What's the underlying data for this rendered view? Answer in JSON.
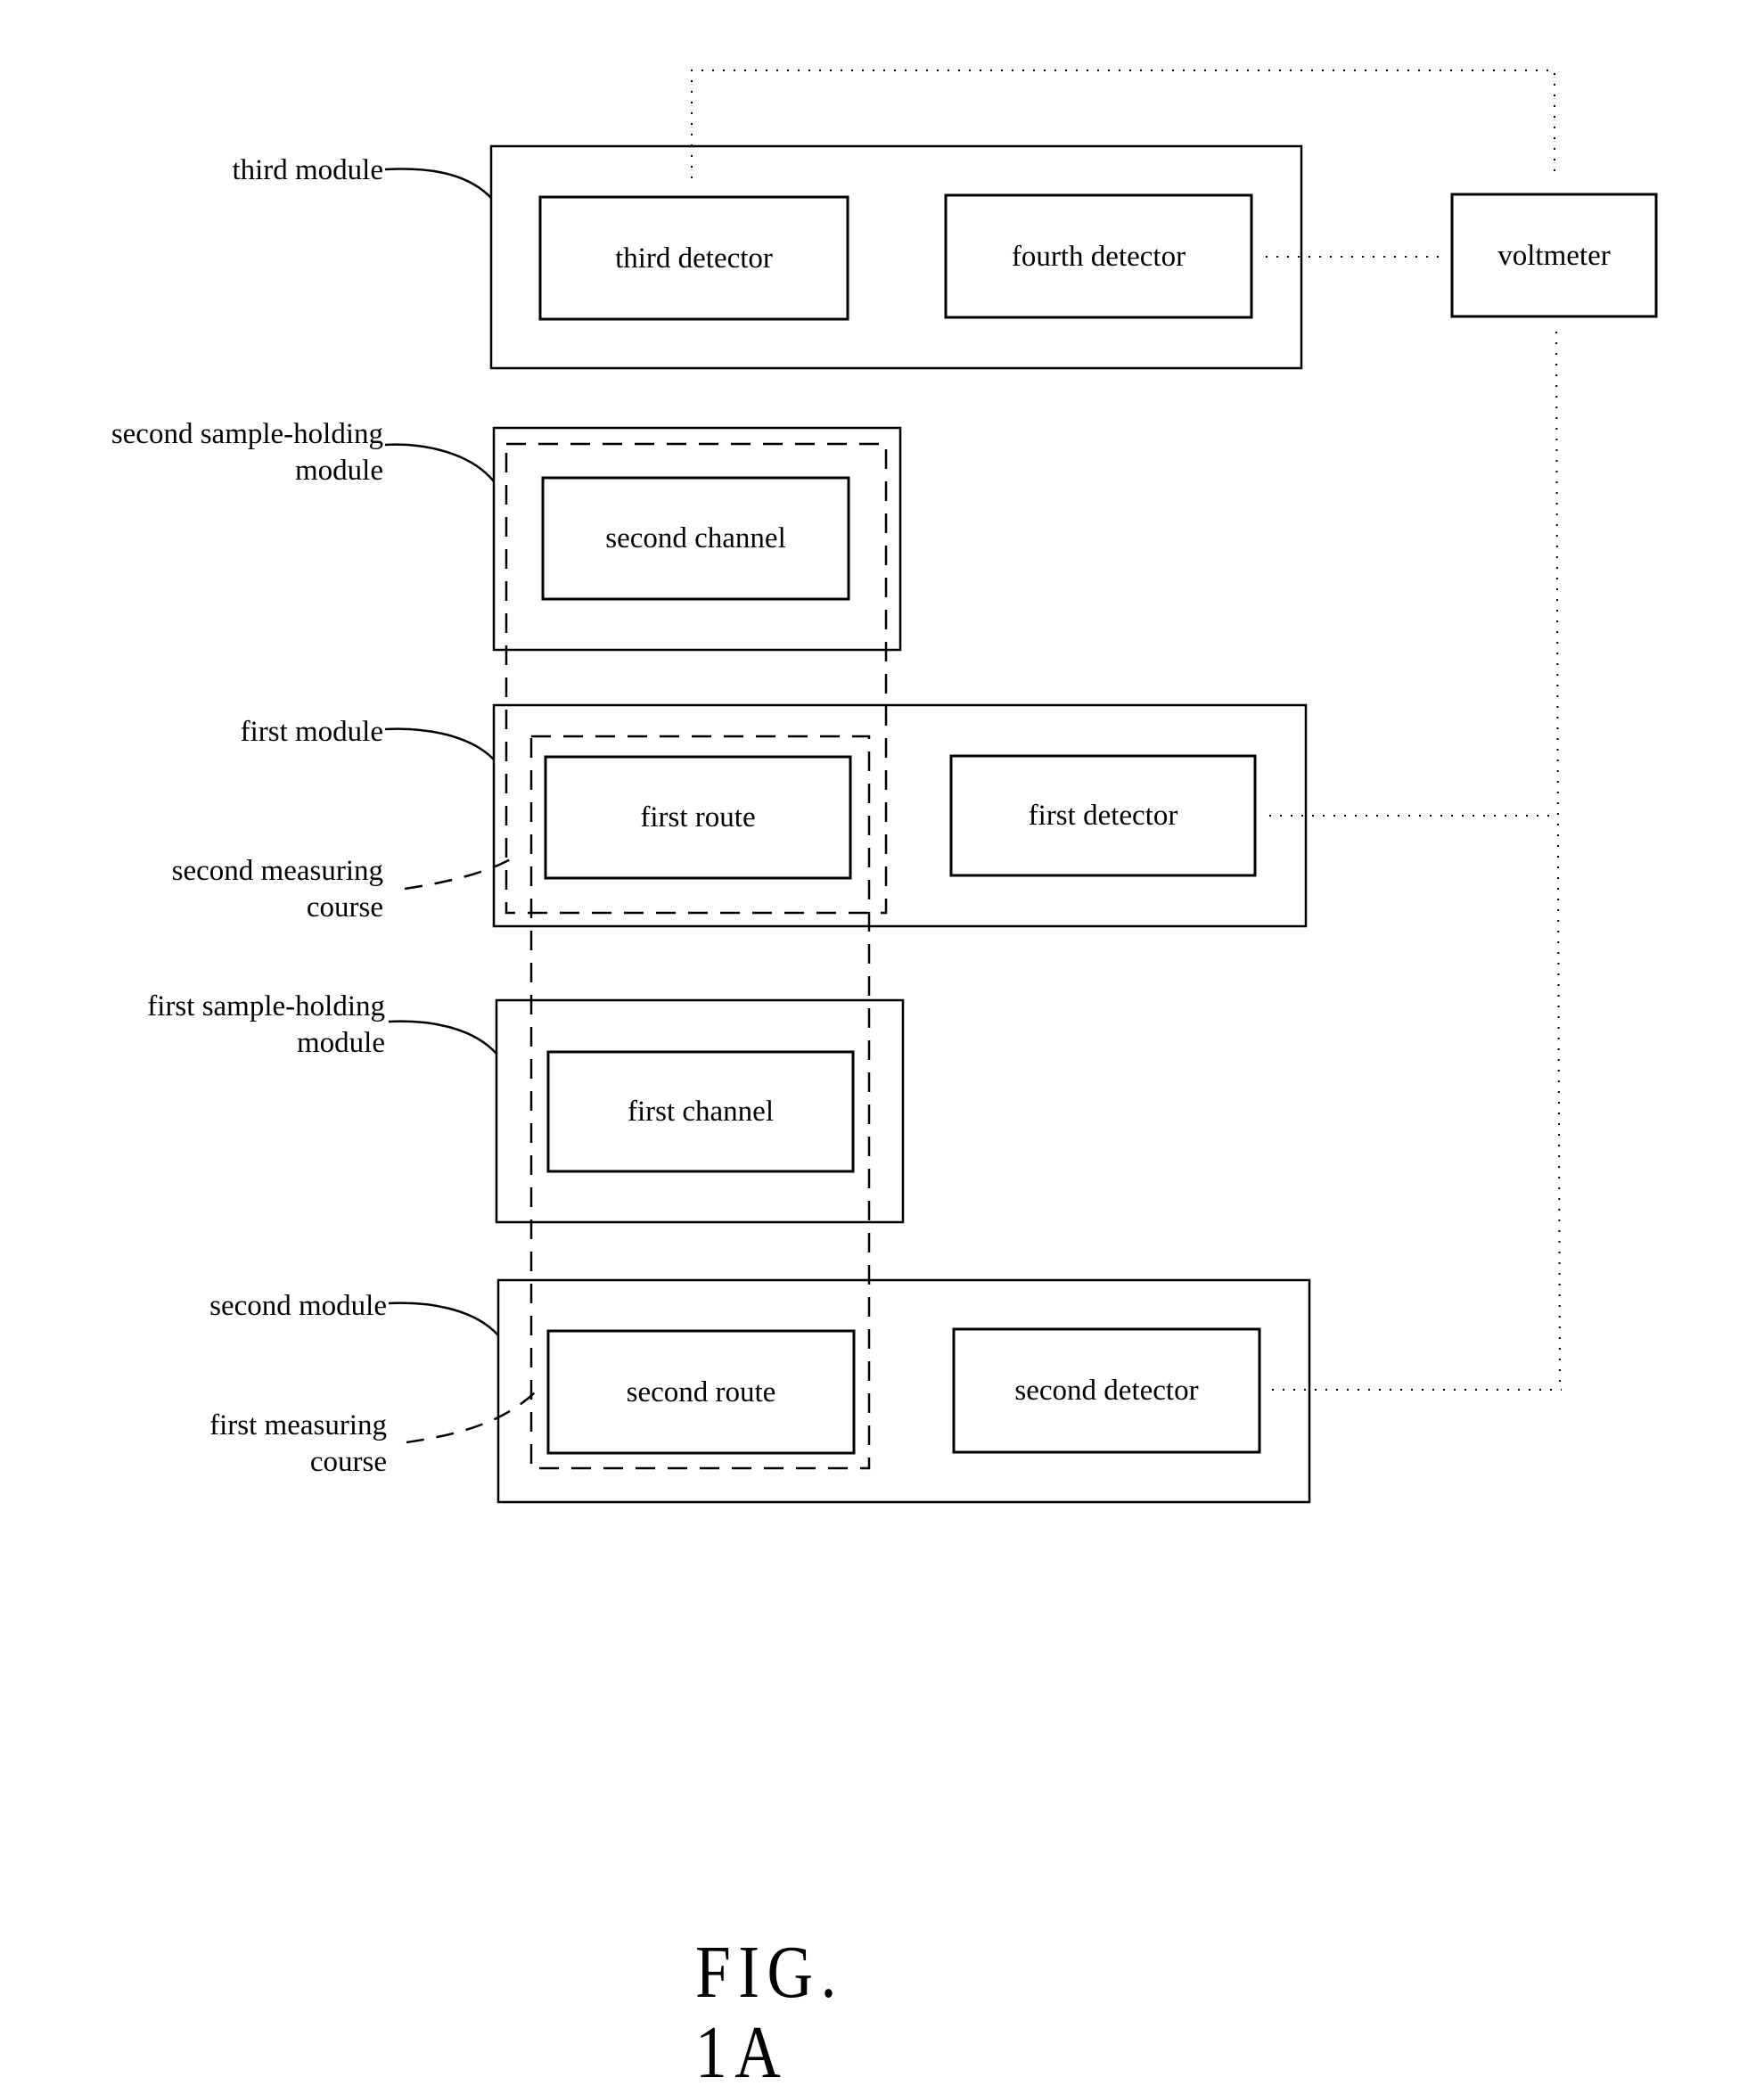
{
  "figure": {
    "caption": "FIG. 1A"
  },
  "components": {
    "third_detector": "third detector",
    "fourth_detector": "fourth detector",
    "voltmeter": "voltmeter",
    "second_channel": "second channel",
    "first_route": "first route",
    "first_detector": "first detector",
    "first_channel": "first channel",
    "second_route": "second route",
    "second_detector": "second detector"
  },
  "labels": {
    "third_module": "third module",
    "second_sample_holding_module": [
      "second sample-holding",
      "module"
    ],
    "first_module": "first module",
    "second_measuring_course": [
      "second measuring",
      "course"
    ],
    "first_sample_holding_module": [
      "first sample-holding",
      "module"
    ],
    "second_module": "second module",
    "first_measuring_course": [
      "first measuring",
      "course"
    ]
  },
  "connections": [
    {
      "from": "third detector",
      "to": "voltmeter",
      "style": "dotted"
    },
    {
      "from": "fourth detector",
      "to": "voltmeter",
      "style": "dotted"
    },
    {
      "from": "first detector",
      "to": "voltmeter",
      "style": "dotted"
    },
    {
      "from": "second detector",
      "to": "voltmeter",
      "style": "dotted"
    }
  ]
}
